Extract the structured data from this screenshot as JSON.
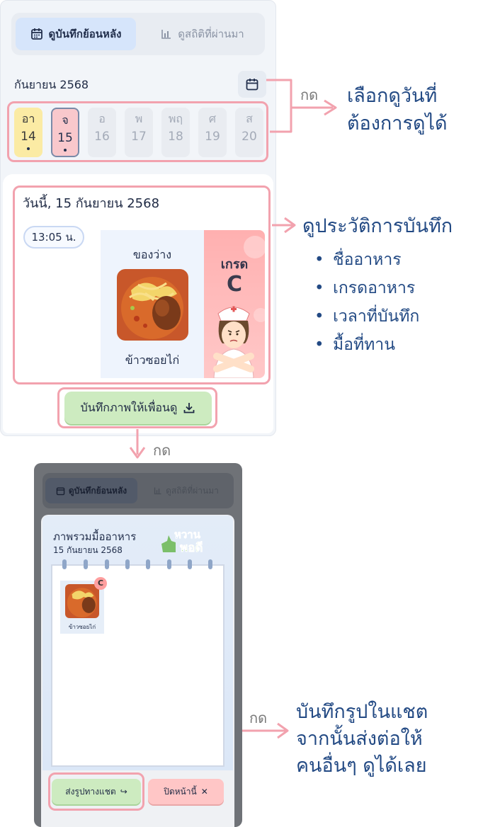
{
  "tabs": {
    "history": "ดูบันทึกย้อนหลัง",
    "stats": "ดูสถิติที่ผ่านมา"
  },
  "calendar": {
    "month_label": "กันยายน 2568",
    "days": [
      {
        "weekday": "อา",
        "date": "14",
        "state": "has-record"
      },
      {
        "weekday": "จ",
        "date": "15",
        "state": "selected"
      },
      {
        "weekday": "อ",
        "date": "16",
        "state": "normal"
      },
      {
        "weekday": "พ",
        "date": "17",
        "state": "normal"
      },
      {
        "weekday": "พฤ",
        "date": "18",
        "state": "normal"
      },
      {
        "weekday": "ศ",
        "date": "19",
        "state": "normal"
      },
      {
        "weekday": "ส",
        "date": "20",
        "state": "normal"
      }
    ]
  },
  "record": {
    "title": "วันนี้, 15 กันยายน 2568",
    "time": "13:05 น.",
    "meal": "ของว่าง",
    "food": "ข้าวซอยไก่",
    "grade_label": "เกรด",
    "grade": "C"
  },
  "save_button": "บันทึกภาพให้เพื่อนดู",
  "annotations": {
    "press": "กด",
    "select_day": [
      "เลือกดูวันที่",
      "ต้องการดูได้"
    ],
    "history": "ดูประวัติการบันทึก",
    "bullets": [
      "ชื่ออาหาร",
      "เกรดอาหาร",
      "เวลาที่บันทึก",
      "มื้อที่ทาน"
    ],
    "chat_note": [
      "บันทึกรูปในแชต",
      "จากนั้นส่งต่อให้",
      "คนอื่นๆ ดูได้เลย"
    ]
  },
  "modal": {
    "summary_title": "ภาพรวมมื้ออาหาร",
    "summary_date": "15 กันยายน 2568",
    "logo_text": [
      "หวาน",
      "พอดี"
    ],
    "item_label": "ข้าวซอยไก่",
    "item_grade": "C",
    "send_button": "ส่งรูปทางแชต",
    "close_button": "ปิดหน้านี้",
    "close_glyph": "✕",
    "send_glyph": "↪"
  },
  "colors": {
    "accent_pink": "#f2a2ae",
    "annotation_blue": "#234a84",
    "green_button": "#cdebc0",
    "red_button": "#ffc6c6"
  }
}
